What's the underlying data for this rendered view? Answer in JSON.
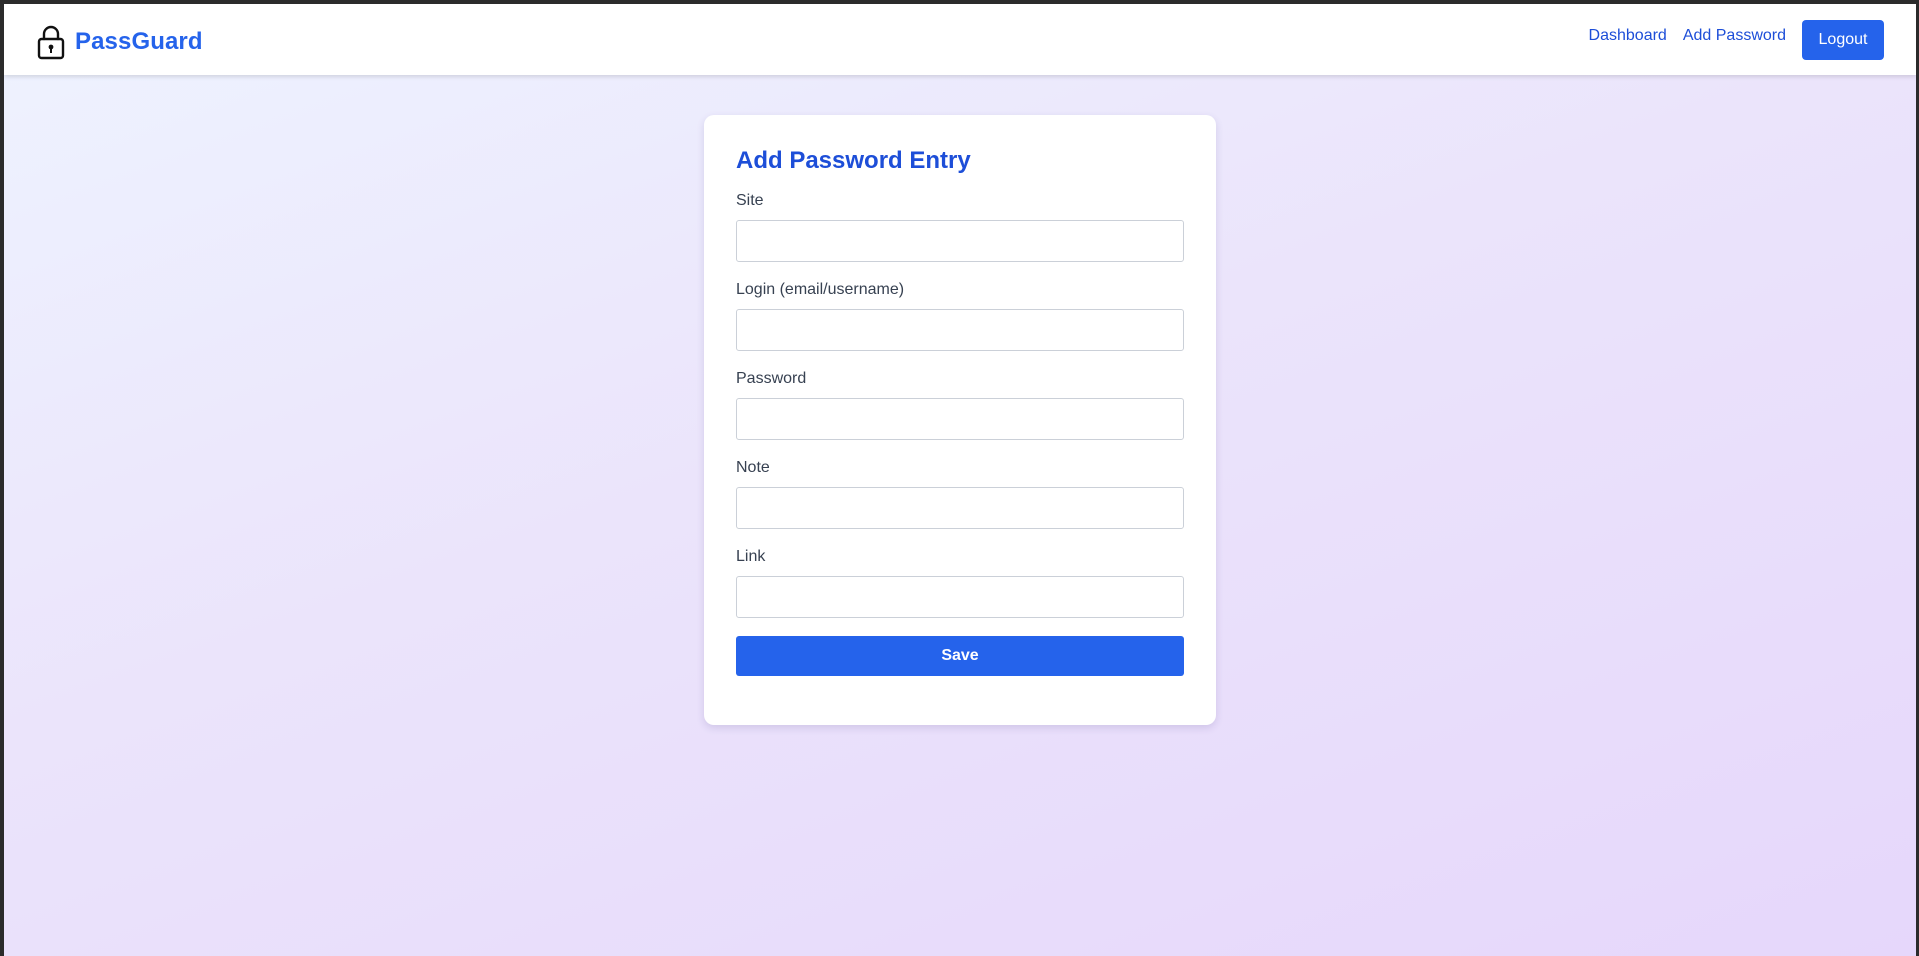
{
  "app": {
    "name": "PassGuard",
    "icon": "lock-icon",
    "accent_color": "#2563eb"
  },
  "nav": {
    "dashboard_label": "Dashboard",
    "add_password_label": "Add Password",
    "logout_label": "Logout"
  },
  "form": {
    "title": "Add Password Entry",
    "fields": [
      {
        "label": "Site",
        "value": ""
      },
      {
        "label": "Login (email/username)",
        "value": ""
      },
      {
        "label": "Password",
        "value": ""
      },
      {
        "label": "Note",
        "value": ""
      },
      {
        "label": "Link",
        "value": ""
      }
    ],
    "save_label": "Save"
  }
}
